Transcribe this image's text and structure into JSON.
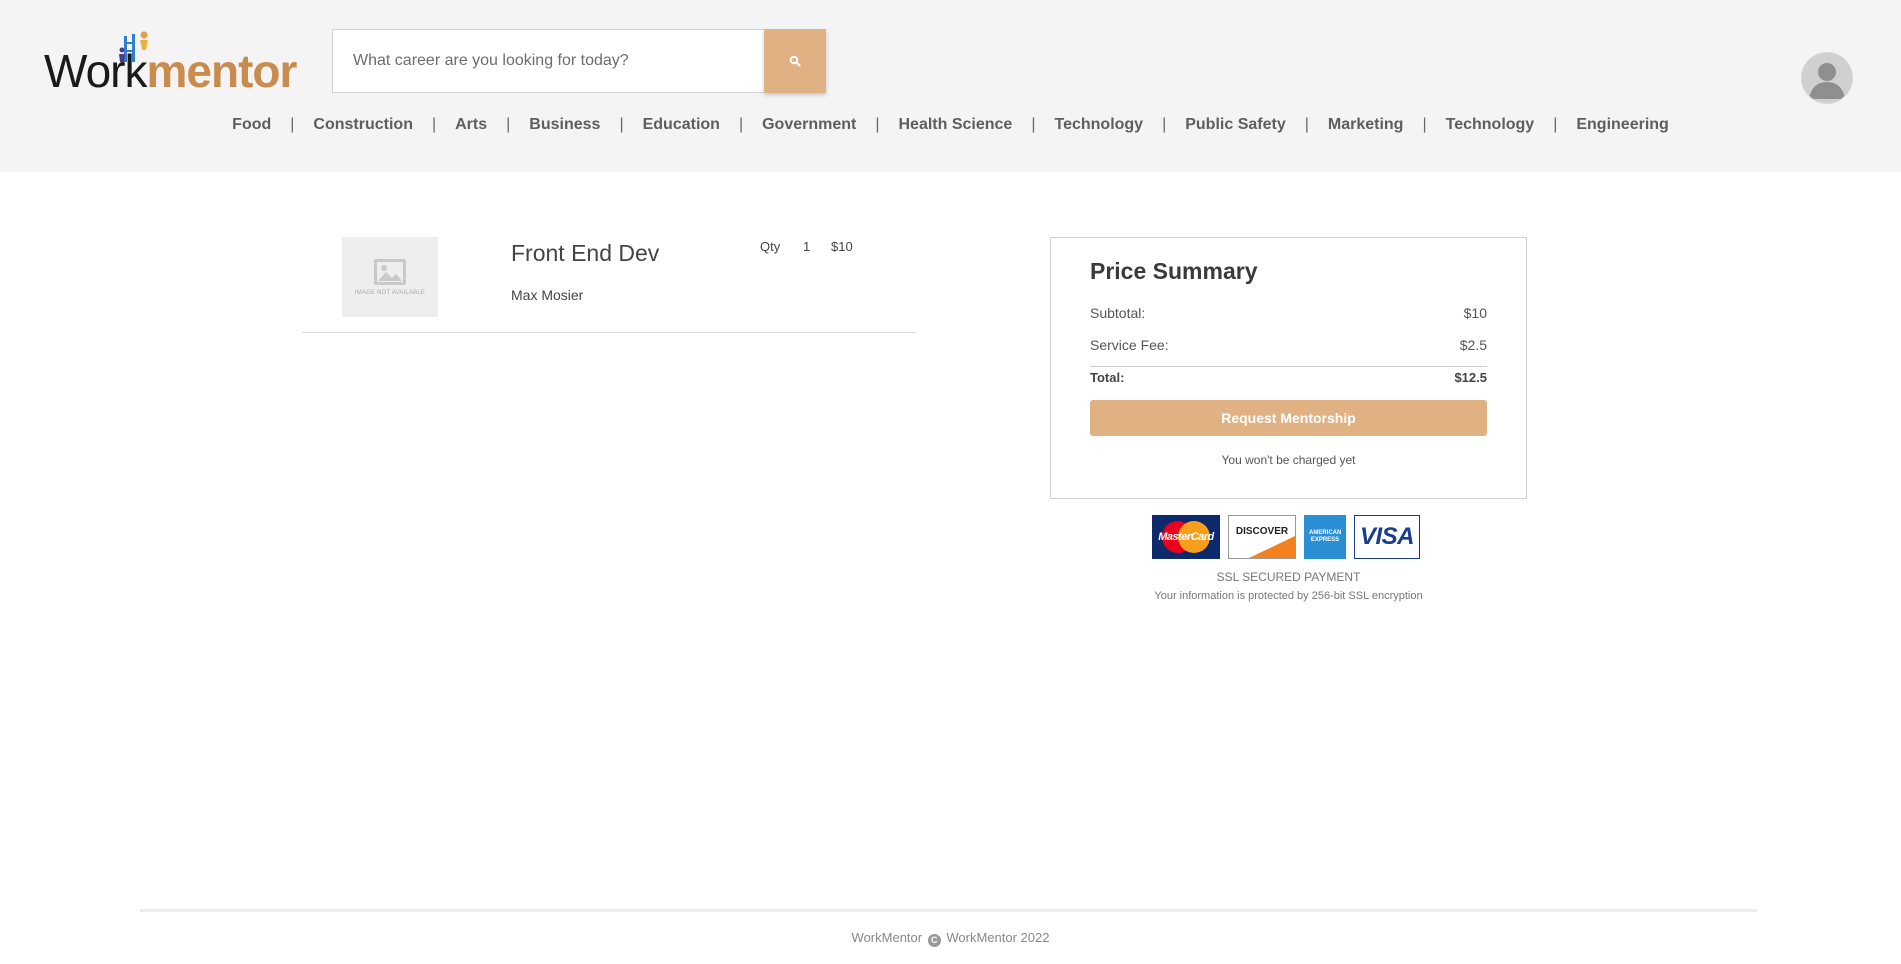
{
  "brand": {
    "logo_part1": "Work",
    "logo_part2": "mentor"
  },
  "search": {
    "placeholder": "What career are you looking for today?"
  },
  "nav": {
    "items": [
      "Food",
      "Construction",
      "Arts",
      "Business",
      "Education",
      "Government",
      "Health Science",
      "Technology",
      "Public Safety",
      "Marketing",
      "Technology",
      "Engineering"
    ],
    "separator": "|"
  },
  "cart_item": {
    "image_placeholder": "IMAGE NOT AVAILABLE",
    "title": "Front End Dev",
    "mentor": "Max Mosier",
    "qty_label": "Qty",
    "qty": "1",
    "price": "$10"
  },
  "summary": {
    "title": "Price Summary",
    "subtotal_label": "Subtotal:",
    "subtotal": "$10",
    "fee_label": "Service Fee:",
    "fee": "$2.5",
    "total_label": "Total:",
    "total": "$12.5",
    "button": "Request Mentorship",
    "note": "You won't be charged yet"
  },
  "payment": {
    "cards": [
      "MasterCard",
      "DISCOVER",
      "AMERICAN EXPRESS",
      "VISA"
    ],
    "ssl_title": "SSL SECURED PAYMENT",
    "ssl_sub": "Your information is protected by 256-bit SSL encryption"
  },
  "footer": {
    "left": "WorkMentor",
    "right": "WorkMentor 2022"
  },
  "colors": {
    "accent": "#e0b283",
    "logo_accent": "#c98c4e",
    "header_bg": "#f4f4f4"
  }
}
